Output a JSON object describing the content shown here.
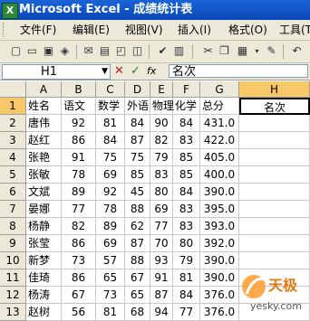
{
  "titlebar": {
    "app_icon": "X",
    "title": "Microsoft Excel - 成绩统计表"
  },
  "menu": [
    {
      "label": "文件(F)"
    },
    {
      "label": "编辑(E)"
    },
    {
      "label": "视图(V)"
    },
    {
      "label": "插入(I)"
    },
    {
      "label": "格式(O)"
    },
    {
      "label": "工具(T)"
    }
  ],
  "toolbar": {
    "icons": [
      "new-icon",
      "open-icon",
      "save-icon",
      "permission-icon",
      "print-icon",
      "print-preview-icon",
      "spelling-icon",
      "research-icon",
      "cut-icon",
      "copy-icon",
      "paste-icon",
      "format-painter-icon",
      "undo-icon"
    ]
  },
  "formula_bar": {
    "name_box": "H1",
    "cancel_icon": "✕",
    "enter_icon": "✓",
    "fx_icon": "fx",
    "content": "名次"
  },
  "grid": {
    "columns": [
      "A",
      "B",
      "C",
      "D",
      "E",
      "F",
      "G",
      "H"
    ],
    "selected_column": "H",
    "rows": [
      {
        "num": "1",
        "cells": [
          "姓名",
          "语文",
          "数学",
          "外语",
          "物理",
          "化学",
          "总分",
          "名次"
        ]
      },
      {
        "num": "2",
        "cells": [
          "唐伟",
          "92",
          "81",
          "84",
          "90",
          "84",
          "431.0",
          ""
        ]
      },
      {
        "num": "3",
        "cells": [
          "赵红",
          "86",
          "84",
          "87",
          "82",
          "83",
          "422.0",
          ""
        ]
      },
      {
        "num": "4",
        "cells": [
          "张艳",
          "91",
          "75",
          "75",
          "79",
          "85",
          "405.0",
          ""
        ]
      },
      {
        "num": "5",
        "cells": [
          "张敏",
          "78",
          "69",
          "85",
          "83",
          "85",
          "400.0",
          ""
        ]
      },
      {
        "num": "6",
        "cells": [
          "文斌",
          "89",
          "92",
          "45",
          "80",
          "84",
          "390.0",
          ""
        ]
      },
      {
        "num": "7",
        "cells": [
          "晏娜",
          "77",
          "78",
          "88",
          "69",
          "83",
          "395.0",
          ""
        ]
      },
      {
        "num": "8",
        "cells": [
          "杨静",
          "82",
          "89",
          "62",
          "77",
          "83",
          "393.0",
          ""
        ]
      },
      {
        "num": "9",
        "cells": [
          "张莹",
          "86",
          "69",
          "87",
          "70",
          "80",
          "392.0",
          ""
        ]
      },
      {
        "num": "10",
        "cells": [
          "新梦",
          "73",
          "57",
          "88",
          "93",
          "79",
          "390.0",
          ""
        ]
      },
      {
        "num": "11",
        "cells": [
          "佳琦",
          "86",
          "65",
          "67",
          "91",
          "81",
          "390.0",
          ""
        ]
      },
      {
        "num": "12",
        "cells": [
          "杨涛",
          "67",
          "73",
          "65",
          "87",
          "84",
          "376.0",
          ""
        ]
      },
      {
        "num": "13",
        "cells": [
          "赵树",
          "56",
          "81",
          "68",
          "94",
          "77",
          "376.0",
          ""
        ]
      }
    ]
  },
  "watermark": {
    "brand": "天极",
    "url": "yesky.com"
  }
}
